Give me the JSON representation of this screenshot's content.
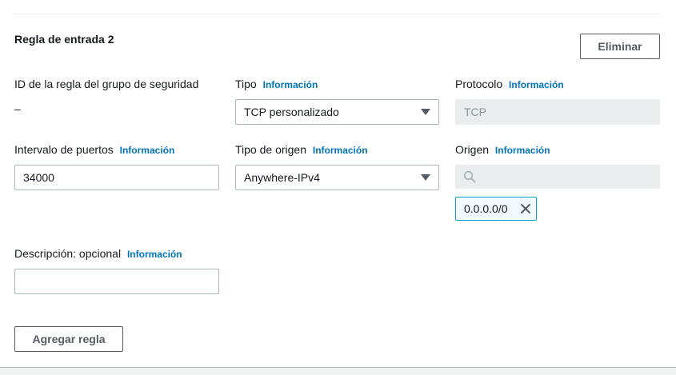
{
  "rule": {
    "title": "Regla de entrada 2",
    "remove_label": "Eliminar"
  },
  "info_link": "Información",
  "security_group_rule_id": {
    "label": "ID de la regla del grupo de seguridad",
    "value": "–"
  },
  "type": {
    "label": "Tipo",
    "value": "TCP personalizado"
  },
  "protocol": {
    "label": "Protocolo",
    "value": "TCP"
  },
  "port_range": {
    "label": "Intervalo de puertos",
    "value": "34000"
  },
  "source_type": {
    "label": "Tipo de origen",
    "value": "Anywhere-IPv4"
  },
  "source": {
    "label": "Origen",
    "search_placeholder": "",
    "token": "0.0.0.0/0"
  },
  "description": {
    "label": "Descripción: opcional",
    "value": ""
  },
  "add_rule_label": "Agregar regla",
  "colors": {
    "link": "#0073bb",
    "token_border": "#00a1c9",
    "disabled_bg": "#eaeded"
  },
  "icons": [
    "caret-down-icon",
    "search-icon",
    "close-icon"
  ]
}
